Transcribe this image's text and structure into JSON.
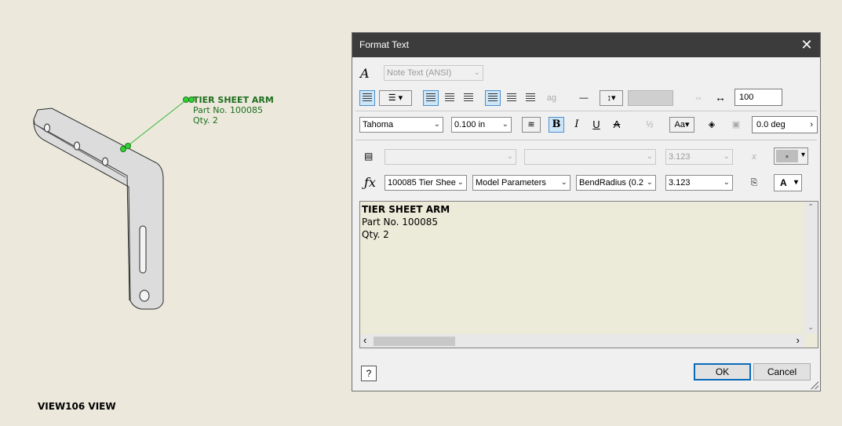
{
  "drawing": {
    "leader": {
      "line1": "TIER SHEET ARM",
      "line2": "Part No. 100085",
      "line3": "Qty. 2"
    },
    "view_label": "VIEW106 VIEW"
  },
  "dialog": {
    "title": "Format Text",
    "close_glyph": "✕",
    "style_select": {
      "value": "Note Text (ANSI)"
    },
    "font_select": {
      "value": "Tahoma"
    },
    "size_select": {
      "value": "0.100 in"
    },
    "width_scale": "100",
    "rotation": "0.0 deg",
    "param_row1": {
      "select1": "",
      "select2": "",
      "select3": "3.123"
    },
    "param_row2": {
      "component": "100085 Tier Shee",
      "source": "Model Parameters",
      "parameter": "BendRadius (0.2",
      "precision": "3.123"
    },
    "color_button_label": "A",
    "editor_lines": [
      "TIER SHEET ARM",
      "Part No. 100085",
      "Qty. 2"
    ],
    "ok_label": "OK",
    "cancel_label": "Cancel",
    "help_label": "?"
  },
  "colors": {
    "leader": "#1e6e1e",
    "titlebar": "#3c3c3c",
    "canvas": "#ece9dc"
  }
}
